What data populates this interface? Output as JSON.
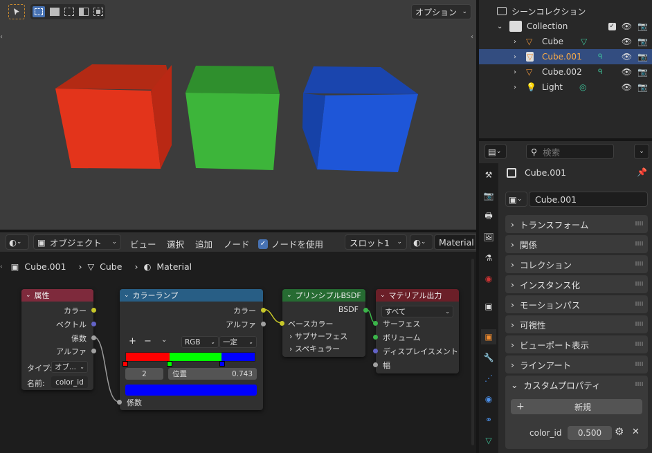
{
  "viewport": {
    "options_label": "オプション",
    "cube_colors": [
      "#e3341b",
      "#3db53a",
      "#1e56d8"
    ]
  },
  "outliner": {
    "scene_collection": "シーンコレクション",
    "collection": "Collection",
    "items": [
      {
        "label": "Cube",
        "icon": "mesh-triangle-icon"
      },
      {
        "label": "Cube.001",
        "icon": "mesh-triangle-icon"
      },
      {
        "label": "Cube.002",
        "icon": "mesh-triangle-icon"
      },
      {
        "label": "Light",
        "icon": "light-bulb-icon"
      }
    ]
  },
  "properties": {
    "search_placeholder": "検索",
    "object_name": "Cube.001",
    "datablock_name": "Cube.001",
    "panels": [
      "トランスフォーム",
      "関係",
      "コレクション",
      "インスタンス化",
      "モーションパス",
      "可視性",
      "ビューポート表示",
      "ラインアート"
    ],
    "custom_props": {
      "title": "カスタムプロパティ",
      "new_label": "新規",
      "prop_name": "color_id",
      "prop_value": "0.500"
    }
  },
  "node_header": {
    "object_mode": "オブジェクト",
    "menus": [
      "ビュー",
      "選択",
      "追加",
      "ノード"
    ],
    "use_nodes_label": "ノードを使用",
    "slot": "スロット1",
    "material": "Material"
  },
  "breadcrumb": {
    "object": "Cube.001",
    "mesh": "Cube",
    "material": "Material"
  },
  "nodes": {
    "attribute": {
      "title": "属性",
      "outputs": [
        "カラー",
        "ベクトル",
        "係数",
        "アルファ"
      ],
      "type_label": "タイプ:",
      "type_value": "オブ...",
      "name_label": "名前:",
      "name_value": "color_id"
    },
    "color_ramp": {
      "title": "カラーランプ",
      "outputs": [
        "カラー",
        "アルファ"
      ],
      "mode": "RGB",
      "interp": "一定",
      "index": "2",
      "pos_label": "位置",
      "pos_value": "0.743",
      "input": "係数",
      "stops": [
        "#ff0000",
        "#00ff00",
        "#0000ff"
      ],
      "stop_positions": [
        0,
        0.34,
        0.743
      ]
    },
    "bsdf": {
      "title": "プリンシプルBSDF",
      "output": "BSDF",
      "inputs": [
        "ベースカラー",
        "サブサーフェス",
        "スペキュラー"
      ]
    },
    "output": {
      "title": "マテリアル出力",
      "target": "すべて",
      "inputs": [
        "サーフェス",
        "ボリューム",
        "ディスプレイスメント",
        "幅"
      ]
    }
  }
}
